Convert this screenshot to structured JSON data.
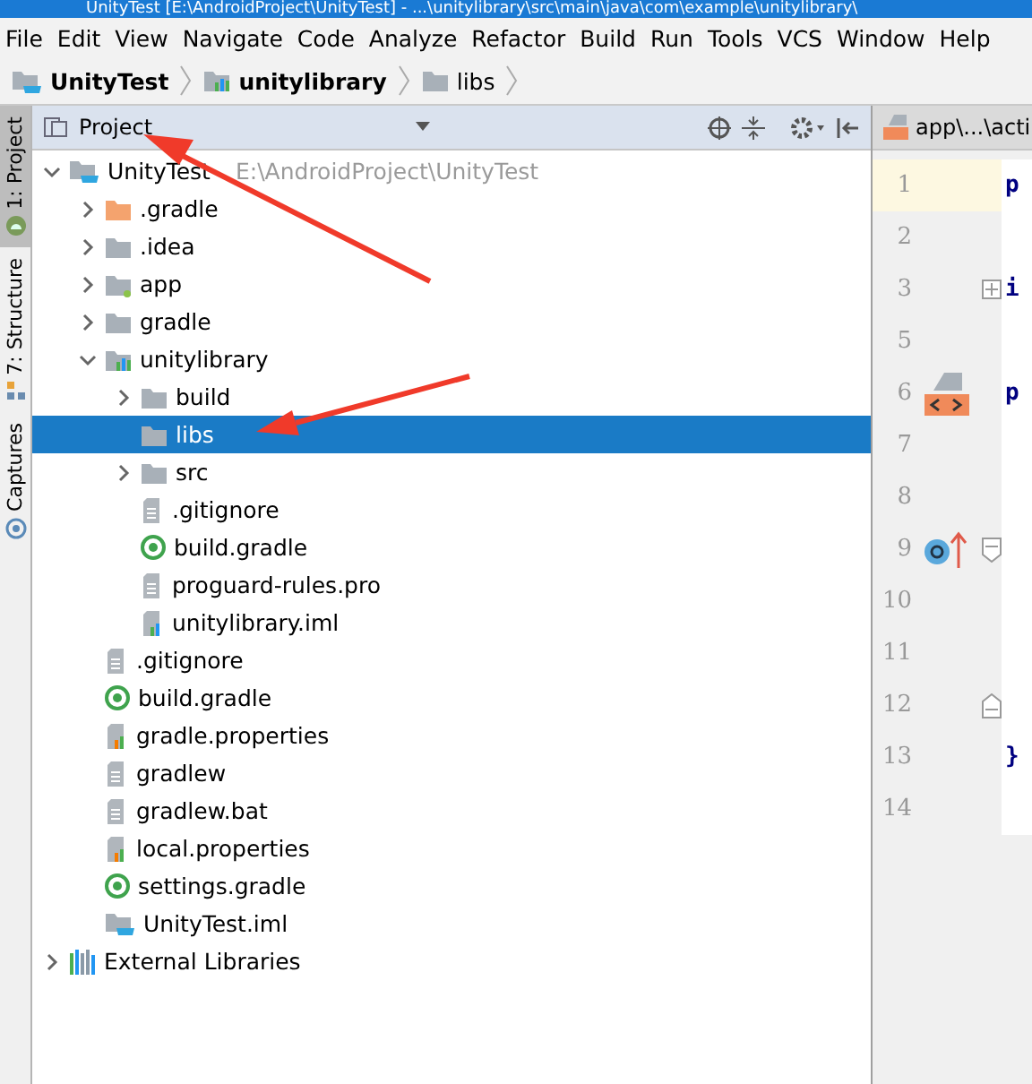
{
  "window": {
    "title": "UnityTest [E:\\AndroidProject\\UnityTest] - ...\\unitylibrary\\src\\main\\java\\com\\example\\unitylibrary\\"
  },
  "menu": [
    "File",
    "Edit",
    "View",
    "Navigate",
    "Code",
    "Analyze",
    "Refactor",
    "Build",
    "Run",
    "Tools",
    "VCS",
    "Window",
    "Help"
  ],
  "breadcrumbs": [
    {
      "label": "UnityTest",
      "kind": "project"
    },
    {
      "label": "unitylibrary",
      "kind": "module"
    },
    {
      "label": "libs",
      "kind": "folder"
    }
  ],
  "side_tabs": [
    {
      "label": "1: Project",
      "selected": true,
      "kind": "android"
    },
    {
      "label": "7: Structure",
      "selected": false,
      "kind": "structure"
    },
    {
      "label": "Captures",
      "selected": false,
      "kind": "captures"
    }
  ],
  "project_panel": {
    "title": "Project"
  },
  "tree": [
    {
      "label": "UnityTest",
      "path": "E:\\AndroidProject\\UnityTest",
      "kind": "project",
      "selected": false,
      "expanded": true,
      "children": [
        {
          "label": ".gradle",
          "kind": "folder-orange",
          "selected": false,
          "expanded": false
        },
        {
          "label": ".idea",
          "kind": "folder",
          "selected": false,
          "expanded": false
        },
        {
          "label": "app",
          "kind": "app-folder",
          "selected": false,
          "expanded": false
        },
        {
          "label": "gradle",
          "kind": "folder",
          "selected": false,
          "expanded": false
        },
        {
          "label": "unitylibrary",
          "kind": "module",
          "selected": false,
          "expanded": true,
          "children": [
            {
              "label": "build",
              "kind": "folder",
              "selected": false,
              "expanded": false
            },
            {
              "label": "libs",
              "kind": "folder",
              "selected": true
            },
            {
              "label": "src",
              "kind": "folder",
              "selected": false,
              "expanded": false
            },
            {
              "label": ".gitignore",
              "kind": "text",
              "selected": false
            },
            {
              "label": "build.gradle",
              "kind": "gradle",
              "selected": false
            },
            {
              "label": "proguard-rules.pro",
              "kind": "text",
              "selected": false
            },
            {
              "label": "unitylibrary.iml",
              "kind": "module-file",
              "selected": false
            }
          ]
        },
        {
          "label": ".gitignore",
          "kind": "text",
          "selected": false
        },
        {
          "label": "build.gradle",
          "kind": "gradle",
          "selected": false
        },
        {
          "label": "gradle.properties",
          "kind": "properties",
          "selected": false
        },
        {
          "label": "gradlew",
          "kind": "text",
          "selected": false
        },
        {
          "label": "gradlew.bat",
          "kind": "text",
          "selected": false
        },
        {
          "label": "local.properties",
          "kind": "properties",
          "selected": false
        },
        {
          "label": "settings.gradle",
          "kind": "gradle",
          "selected": false
        },
        {
          "label": "UnityTest.iml",
          "kind": "project",
          "selected": false
        }
      ]
    },
    {
      "label": "External Libraries",
      "kind": "libraries",
      "selected": false,
      "expanded": false
    }
  ],
  "editor": {
    "tab": "app\\...\\acti",
    "lines": [
      {
        "number": "1",
        "code": "p",
        "current": true
      },
      {
        "number": "2",
        "current": false
      },
      {
        "number": "3",
        "code": "i",
        "current": false,
        "folds": [
          {
            "kind": "plus"
          }
        ]
      },
      {
        "number": "5",
        "current": false
      },
      {
        "number": "6",
        "code": "p",
        "current": false,
        "markers": [
          {
            "kind": "xml"
          }
        ]
      },
      {
        "number": "7",
        "current": false
      },
      {
        "number": "8",
        "current": false
      },
      {
        "number": "9",
        "current": false,
        "markers": [
          {
            "kind": "override"
          }
        ],
        "folds": [
          {
            "kind": "start"
          }
        ]
      },
      {
        "number": "10",
        "current": false
      },
      {
        "number": "11",
        "current": false
      },
      {
        "number": "12",
        "current": false,
        "folds": [
          {
            "kind": "end"
          }
        ]
      },
      {
        "number": "13",
        "code": "}",
        "current": false
      },
      {
        "number": "14",
        "current": false
      }
    ]
  }
}
